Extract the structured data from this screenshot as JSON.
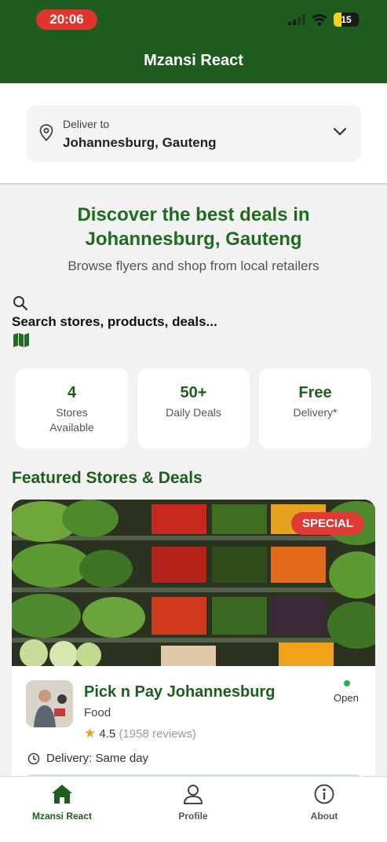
{
  "status_bar": {
    "time": "20:06",
    "battery": "15"
  },
  "header": {
    "title": "Mzansi React"
  },
  "deliver": {
    "label": "Deliver to",
    "location": "Johannesburg, Gauteng"
  },
  "hero": {
    "title": "Discover the best deals in Johannesburg, Gauteng",
    "subtitle": "Browse flyers and shop from local retailers"
  },
  "search": {
    "placeholder": "Search stores, products, deals..."
  },
  "stats": [
    {
      "value": "4",
      "label": "Stores Available"
    },
    {
      "value": "50+",
      "label": "Daily Deals"
    },
    {
      "value": "Free",
      "label": "Delivery*"
    }
  ],
  "featured": {
    "title": "Featured Stores & Deals",
    "card": {
      "badge": "SPECIAL",
      "store_name": "Pick n Pay Johannesburg",
      "category": "Food",
      "rating": "4.5",
      "reviews": "(1958 reviews)",
      "status": "Open",
      "delivery": "Delivery: Same day"
    }
  },
  "tabs": [
    {
      "label": "Mzansi React",
      "icon": "home-icon",
      "active": true
    },
    {
      "label": "Profile",
      "icon": "profile-icon",
      "active": false
    },
    {
      "label": "About",
      "icon": "info-icon",
      "active": false
    }
  ],
  "colors": {
    "brand": "#1f5c1f",
    "badge": "#e03a36",
    "open": "#2bb24c"
  }
}
